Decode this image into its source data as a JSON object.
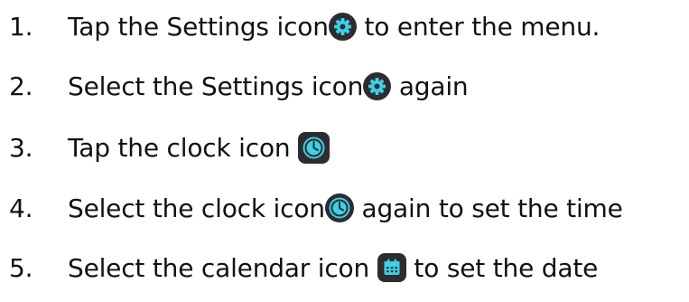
{
  "steps": [
    {
      "number": "1.",
      "before": "Tap the Settings icon",
      "after": " to enter the menu.",
      "icon": "settings-gear-icon"
    },
    {
      "number": "2.",
      "before": "Select the Settings icon",
      "after": " again",
      "icon": "settings-gear-icon"
    },
    {
      "number": "3.",
      "before": "Tap the clock icon ",
      "after": "",
      "icon": "clock-icon"
    },
    {
      "number": "4.",
      "before": "Select the clock icon",
      "after": " again to set the time",
      "icon": "clock-icon"
    },
    {
      "number": "5.",
      "before": "Select the calendar icon ",
      "after": " to set the date",
      "icon": "calendar-icon"
    }
  ],
  "colors": {
    "icon_background": "#2c2c31",
    "icon_accent": "#3fd0e6",
    "text": "#111111"
  }
}
